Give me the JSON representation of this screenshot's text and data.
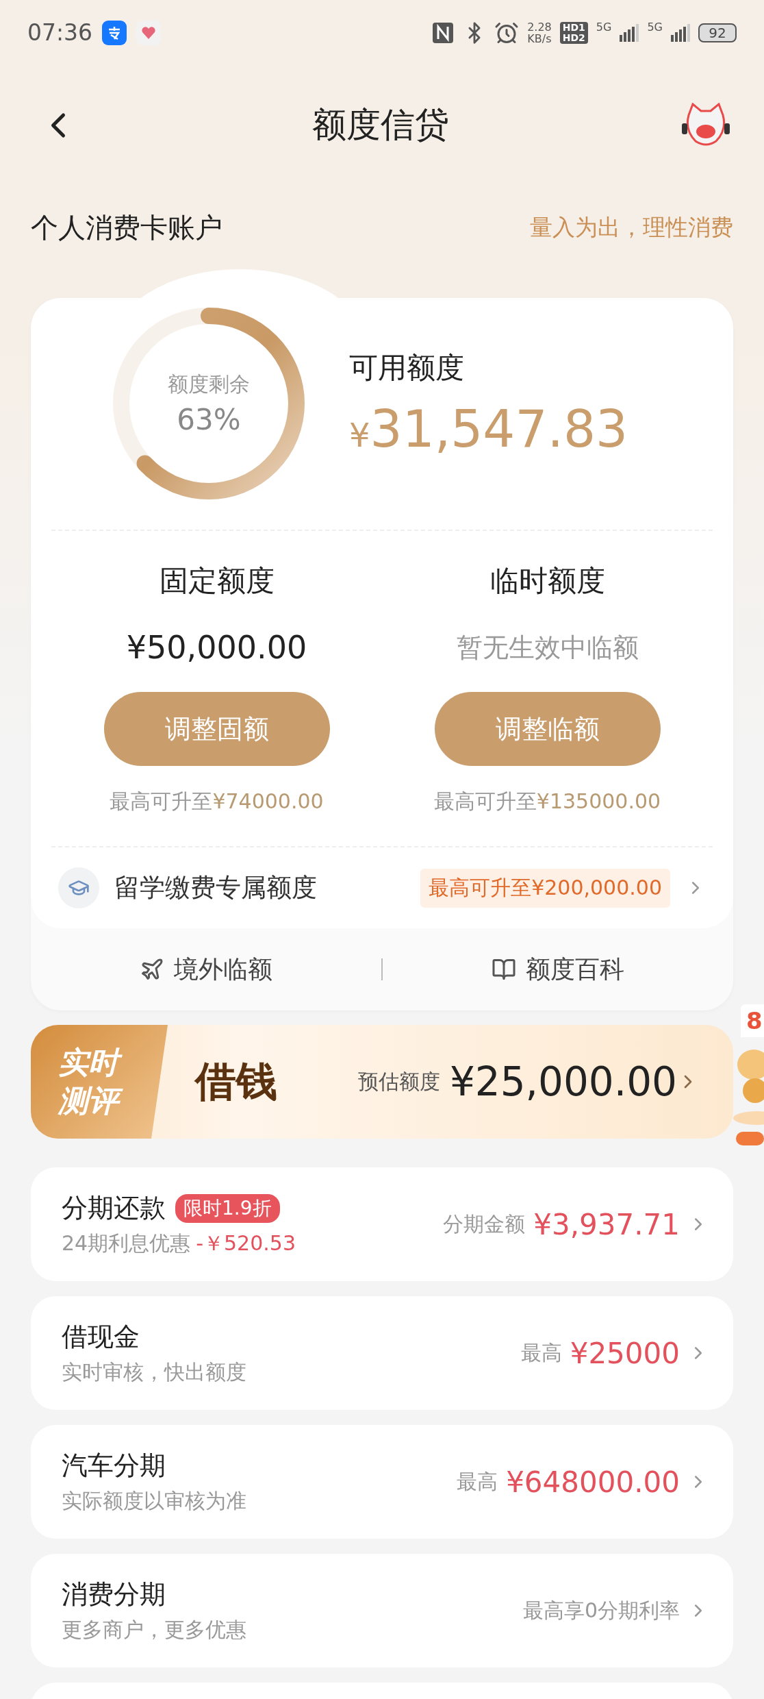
{
  "status_bar": {
    "time": "07:36",
    "net_speed": "2.28",
    "net_unit": "KB/s",
    "hd_top": "HD1",
    "hd_bottom": "HD2",
    "sim1": "5G",
    "sim2": "5G",
    "battery": "92"
  },
  "header": {
    "title": "额度信贷"
  },
  "account": {
    "title": "个人消费卡账户",
    "slogan": "量入为出，理性消费"
  },
  "credit": {
    "ring_label": "额度剩余",
    "ring_value": "63%",
    "level": 0.63,
    "available_label": "可用额度",
    "currency": "¥",
    "available_amount": "31,547.83"
  },
  "limits": [
    {
      "title": "固定额度",
      "kind": "amount",
      "value": "¥50,000.00",
      "button": "调整固额",
      "hint": "最高可升至",
      "hint_amount": "¥74000.00"
    },
    {
      "title": "临时额度",
      "kind": "note",
      "value": "暂无生效中临额",
      "button": "调整临额",
      "hint": "最高可升至",
      "hint_amount": "¥135000.00"
    }
  ],
  "study": {
    "label": "留学缴费专属额度",
    "tag": "最高可升至¥200,000.00"
  },
  "links": [
    {
      "label": "境外临额"
    },
    {
      "label": "额度百科"
    }
  ],
  "banner": {
    "badge_top": "实时",
    "badge_bottom": "测评",
    "title": "借钱",
    "label": "预估额度",
    "amount": "¥25,000.00",
    "promo": "8"
  },
  "products": [
    {
      "title": "分期还款",
      "tag": "限时1.9折",
      "subtitle": "24期利息优惠",
      "discount": "-￥520.53",
      "label": "分期金额",
      "value": "¥3,937.71"
    },
    {
      "title": "借现金",
      "subtitle": "实时审核，快出额度",
      "label": "最高",
      "value": "¥25000"
    },
    {
      "title": "汽车分期",
      "subtitle": "实际额度以审核为准",
      "label": "最高",
      "value": "¥648000.00"
    },
    {
      "title": "消费分期",
      "subtitle": "更多商户，更多优惠",
      "label": "最高享0分期利率"
    }
  ]
}
